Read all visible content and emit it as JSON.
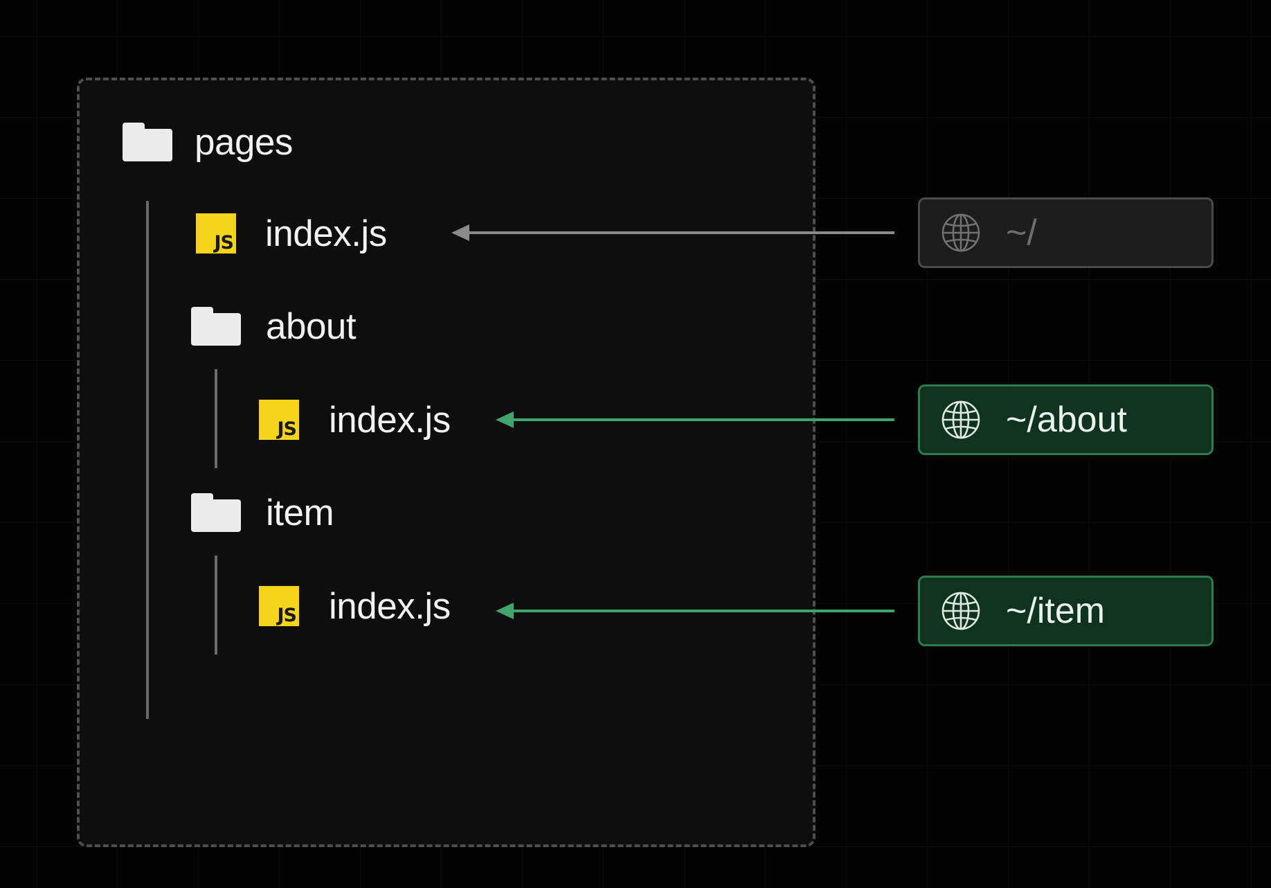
{
  "tree": {
    "root": {
      "name": "pages",
      "icon": "folder-icon"
    },
    "root_file": {
      "name": "index.js",
      "icon": "js-file-icon",
      "badge": "JS"
    },
    "about_folder": {
      "name": "about",
      "icon": "folder-icon"
    },
    "about_file": {
      "name": "index.js",
      "icon": "js-file-icon",
      "badge": "JS"
    },
    "item_folder": {
      "name": "item",
      "icon": "folder-icon"
    },
    "item_file": {
      "name": "index.js",
      "icon": "js-file-icon",
      "badge": "JS"
    }
  },
  "routes": [
    {
      "path": "~/",
      "icon": "globe-icon",
      "state": "inactive"
    },
    {
      "path": "~/about",
      "icon": "globe-icon",
      "state": "active"
    },
    {
      "path": "~/item",
      "icon": "globe-icon",
      "state": "active"
    }
  ],
  "colors": {
    "background": "#030303",
    "panel": "#0e0e0e",
    "folder": "#ececec",
    "js_badge": "#f5d41c",
    "arrow_inactive": "#8a8a8a",
    "arrow_active": "#3fa56d",
    "route_active_bg": "#0f331f",
    "route_active_border": "#2f7a4e"
  }
}
